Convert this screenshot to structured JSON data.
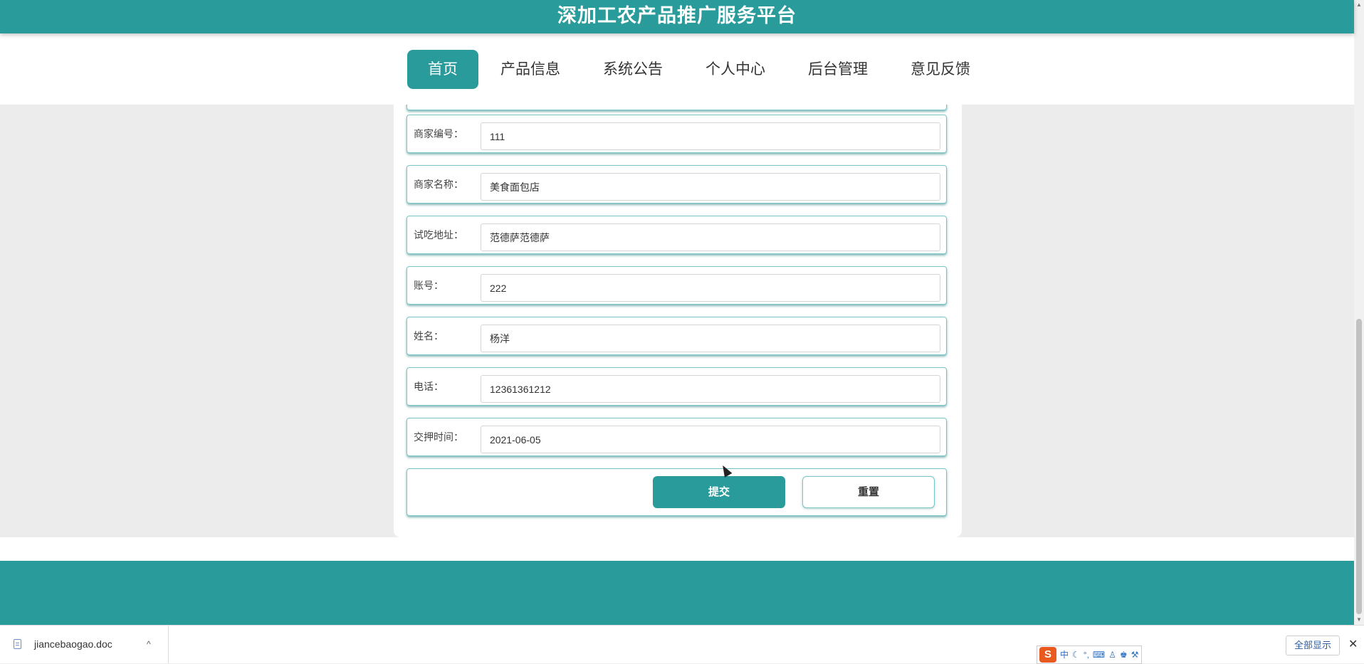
{
  "header": {
    "title": "深加工农产品推广服务平台"
  },
  "nav": {
    "items": [
      {
        "label": "首页",
        "active": true
      },
      {
        "label": "产品信息"
      },
      {
        "label": "系统公告"
      },
      {
        "label": "个人中心"
      },
      {
        "label": "后台管理"
      },
      {
        "label": "意见反馈"
      }
    ]
  },
  "form": {
    "fields": [
      {
        "label": "商家编号：",
        "value": "111"
      },
      {
        "label": "商家名称：",
        "value": "美食面包店"
      },
      {
        "label": "试吃地址：",
        "value": "范德萨范德萨"
      },
      {
        "label": "账号：",
        "value": "222"
      },
      {
        "label": "姓名：",
        "value": "杨洋"
      },
      {
        "label": "电话：",
        "value": "12361361212"
      },
      {
        "label": "交押时间：",
        "value": "2021-06-05"
      }
    ],
    "submit_label": "提交",
    "reset_label": "重置"
  },
  "download_bar": {
    "file_name": "jiancebaogao.doc",
    "show_all_label": "全部显示",
    "close_symbol": "✕",
    "chevron_symbol": "^"
  },
  "ime": {
    "logo": "S",
    "mode": "中",
    "icons": [
      "moon-icon",
      "punctuation-icon",
      "keyboard-icon",
      "user-icon",
      "shirt-icon",
      "wrench-icon"
    ]
  },
  "colors": {
    "brand": "#2a9b9b",
    "page_bg": "#ececec"
  }
}
